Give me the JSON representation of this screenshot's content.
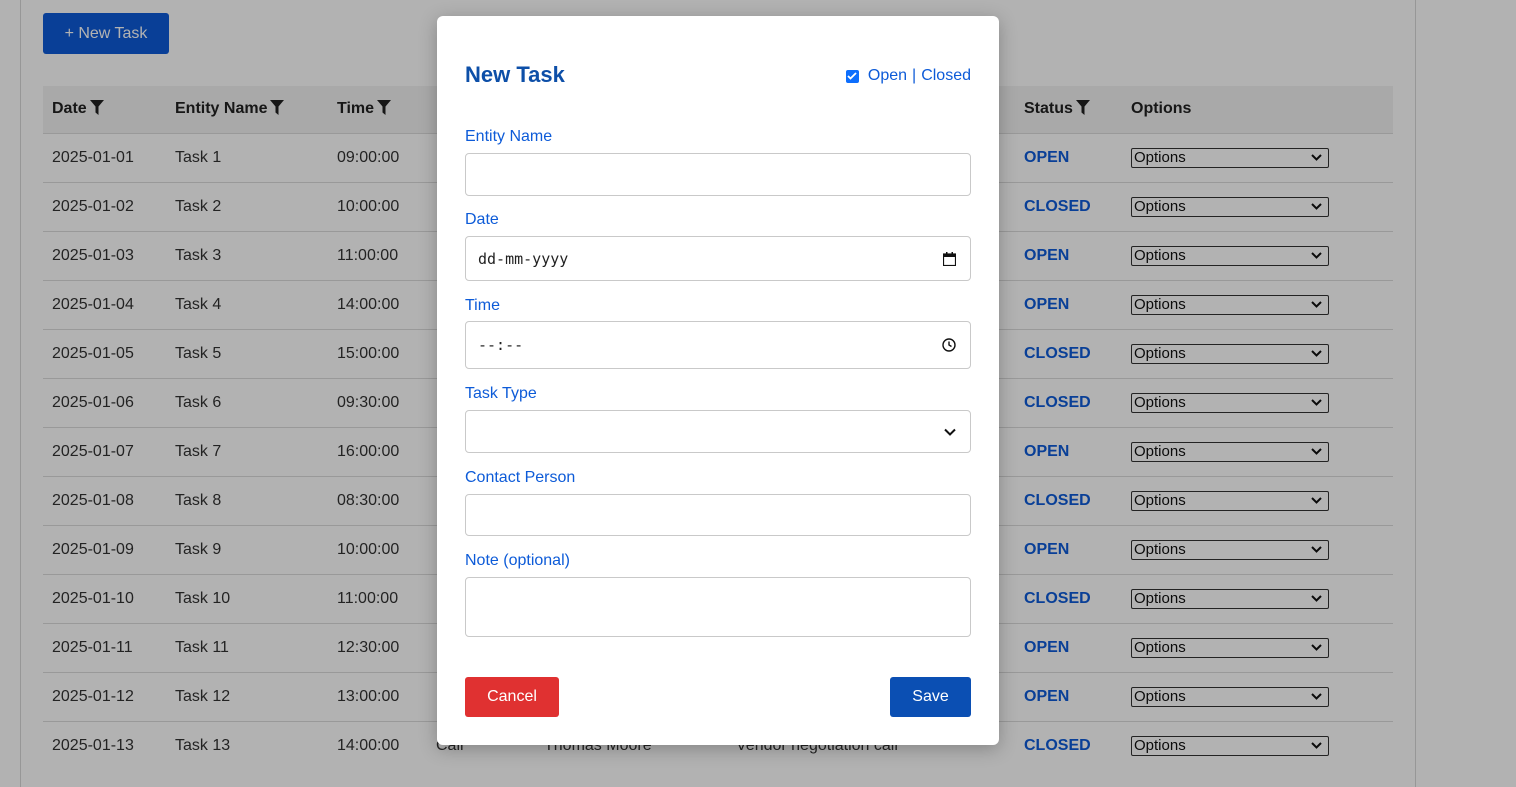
{
  "toolbar": {
    "new_task_label": "+ New Task"
  },
  "table": {
    "columns": [
      "Date",
      "Entity Name",
      "Time",
      "",
      "",
      "",
      "Status",
      "Options"
    ],
    "rows": [
      {
        "date": "2025-01-01",
        "entity": "Task 1",
        "time": "09:00:00",
        "status": "OPEN",
        "option": "Options"
      },
      {
        "date": "2025-01-02",
        "entity": "Task 2",
        "time": "10:00:00",
        "status": "CLOSED",
        "option": "Options"
      },
      {
        "date": "2025-01-03",
        "entity": "Task 3",
        "time": "11:00:00",
        "status": "OPEN",
        "option": "Options"
      },
      {
        "date": "2025-01-04",
        "entity": "Task 4",
        "time": "14:00:00",
        "status": "OPEN",
        "option": "Options"
      },
      {
        "date": "2025-01-05",
        "entity": "Task 5",
        "time": "15:00:00",
        "status": "CLOSED",
        "option": "Options"
      },
      {
        "date": "2025-01-06",
        "entity": "Task 6",
        "time": "09:30:00",
        "status": "CLOSED",
        "option": "Options"
      },
      {
        "date": "2025-01-07",
        "entity": "Task 7",
        "time": "16:00:00",
        "status": "OPEN",
        "option": "Options"
      },
      {
        "date": "2025-01-08",
        "entity": "Task 8",
        "time": "08:30:00",
        "status": "CLOSED",
        "option": "Options"
      },
      {
        "date": "2025-01-09",
        "entity": "Task 9",
        "time": "10:00:00",
        "status": "OPEN",
        "option": "Options"
      },
      {
        "date": "2025-01-10",
        "entity": "Task 10",
        "time": "11:00:00",
        "status": "CLOSED",
        "option": "Options"
      },
      {
        "date": "2025-01-11",
        "entity": "Task 11",
        "time": "12:30:00",
        "status": "OPEN",
        "option": "Options"
      },
      {
        "date": "2025-01-12",
        "entity": "Task 12",
        "time": "13:00:00",
        "status": "OPEN",
        "option": "Options"
      },
      {
        "date": "2025-01-13",
        "entity": "Task 13",
        "time": "14:00:00",
        "type": "Call",
        "contact": "Thomas Moore",
        "note": "Vendor negotiation call",
        "status": "CLOSED",
        "option": "Options"
      }
    ]
  },
  "modal": {
    "title": "New Task",
    "status_toggle": {
      "checked": true,
      "open_label": "Open",
      "separator": "|",
      "closed_label": "Closed"
    },
    "fields": {
      "entity_name": {
        "label": "Entity Name",
        "value": ""
      },
      "date": {
        "label": "Date",
        "placeholder": "dd-mm-yyyy"
      },
      "time": {
        "label": "Time",
        "placeholder": "--:--"
      },
      "task_type": {
        "label": "Task Type",
        "value": ""
      },
      "contact_person": {
        "label": "Contact Person",
        "value": ""
      },
      "note": {
        "label": "Note (optional)",
        "value": ""
      }
    },
    "cancel_label": "Cancel",
    "save_label": "Save"
  },
  "colors": {
    "primary": "#0d5bd8",
    "title": "#0d4fa8",
    "cancel": "#e03131",
    "save": "#0b4fb3",
    "overlay": "rgba(0,0,0,0.30)"
  },
  "icons": {
    "filter": "filter-icon",
    "select_chevron": "chevron-down-icon",
    "calendar": "calendar-icon",
    "clock": "clock-icon"
  }
}
